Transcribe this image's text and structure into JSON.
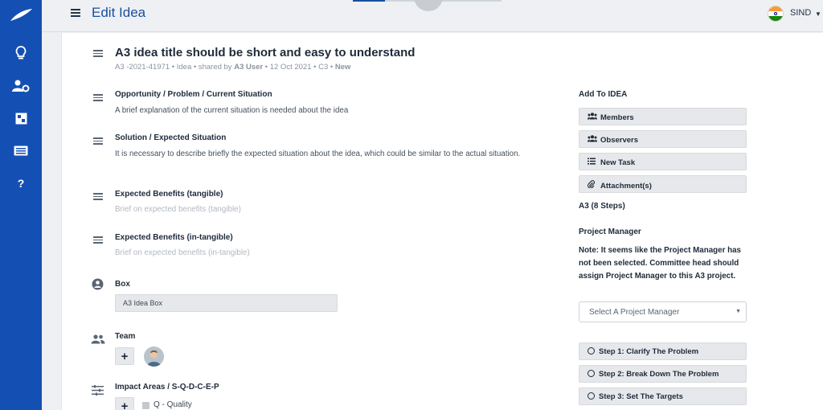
{
  "header": {
    "page_title": "Edit Idea",
    "language": "SIND",
    "flag_colors": [
      "#FF9933",
      "#FFFFFF",
      "#138808"
    ]
  },
  "sidebar": {
    "items": [
      {
        "icon": "lightbulb-icon"
      },
      {
        "icon": "user-settings-icon"
      },
      {
        "icon": "dashboard-icon"
      },
      {
        "icon": "id-card-icon"
      },
      {
        "icon": "help-icon",
        "glyph": "?"
      }
    ]
  },
  "idea": {
    "title": "A3 idea title should be short and easy to understand",
    "meta_prefix": "A3 -2021-41971 • Idea • shared by ",
    "meta_user": "A3 User",
    "meta_suffix": " • 12 Oct 2021 • C3 • ",
    "meta_status": "New"
  },
  "sections": {
    "opportunity": {
      "title": "Opportunity / Problem / Current Situation",
      "text": "A brief explanation of the current situation is needed about the idea"
    },
    "solution": {
      "title": "Solution / Expected Situation",
      "text": "It is necessary to describe briefly the expected situation about the idea, which could be similar to the actual situation."
    },
    "tangible": {
      "title": "Expected Benefits (tangible)",
      "placeholder": "Brief on expected benefits (tangible)"
    },
    "intangible": {
      "title": "Expected Benefits (in-tangible)",
      "placeholder": "Brief on expected benefits (in-tangible)"
    },
    "box": {
      "title": "Box",
      "value": "A3 Idea Box"
    },
    "team": {
      "title": "Team",
      "add_label": "+"
    },
    "impact": {
      "title": "Impact Areas / S-Q-D-C-E-P",
      "add_label": "+",
      "first_option": "Q - Quality"
    }
  },
  "right_panel": {
    "add_title": "Add To IDEA",
    "buttons": [
      {
        "label": "Members",
        "icon": "users-icon"
      },
      {
        "label": "Observers",
        "icon": "users-icon"
      },
      {
        "label": "New Task",
        "icon": "list-icon"
      },
      {
        "label": "Attachment(s)",
        "icon": "paperclip-icon"
      }
    ],
    "a3_title": "A3 (8 Steps)",
    "pm_title": "Project Manager",
    "pm_note": "Note: It seems like the Project Manager has not been selected. Committee head should assign Project Manager to this A3 project.",
    "pm_select_placeholder": "Select A Project Manager",
    "steps": [
      "Step 1: Clarify The Problem",
      "Step 2: Break Down The Problem",
      "Step 3: Set The Targets"
    ]
  },
  "colors": {
    "sidebar": "#1450B4",
    "title_blue": "#1A4FA0"
  }
}
